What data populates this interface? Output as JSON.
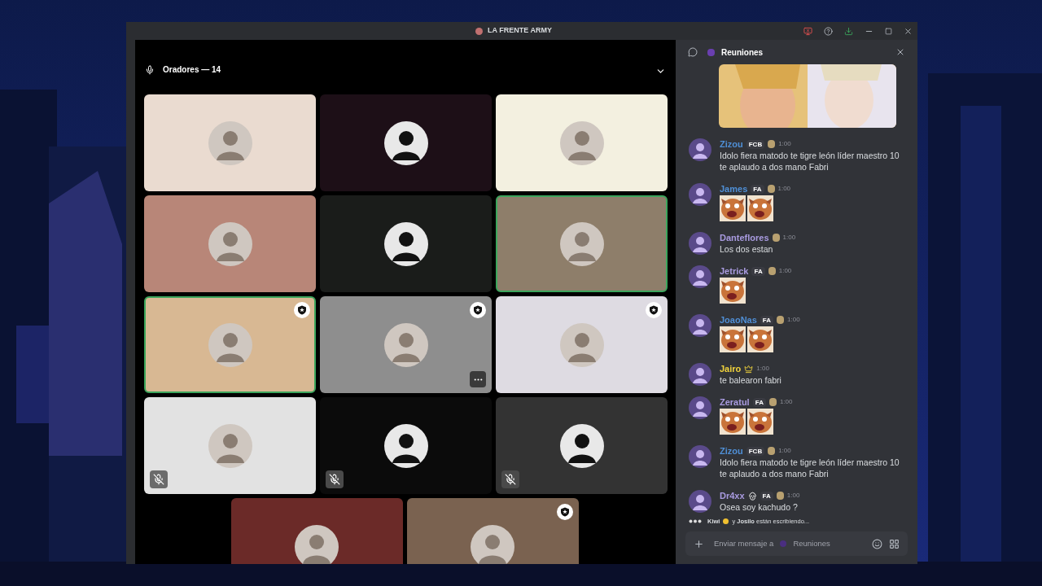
{
  "window": {
    "title": "LA FRENTE ARMY"
  },
  "stage": {
    "header": "Oradores — 14",
    "expanded": true,
    "tiles": [
      {
        "color": "#eadbd0",
        "speaking": false,
        "moderator": false,
        "muted": false,
        "menu": false
      },
      {
        "color": "#1d0f17",
        "speaking": false,
        "moderator": false,
        "muted": false,
        "menu": false
      },
      {
        "color": "#f3f0e0",
        "speaking": false,
        "moderator": false,
        "muted": false,
        "menu": false
      },
      {
        "color": "#b88678",
        "speaking": false,
        "moderator": false,
        "muted": false,
        "menu": false
      },
      {
        "color": "#1a1c1a",
        "speaking": false,
        "moderator": false,
        "muted": false,
        "menu": false
      },
      {
        "color": "#8e7e6a",
        "speaking": true,
        "moderator": false,
        "muted": false,
        "menu": false
      },
      {
        "color": "#d8b893",
        "speaking": true,
        "moderator": true,
        "muted": false,
        "menu": false
      },
      {
        "color": "#8e8e8e",
        "speaking": false,
        "moderator": true,
        "muted": false,
        "menu": true
      },
      {
        "color": "#dedbe2",
        "speaking": false,
        "moderator": true,
        "muted": false,
        "menu": false
      },
      {
        "color": "#e2e2e2",
        "speaking": false,
        "moderator": false,
        "muted": true,
        "menu": false
      },
      {
        "color": "#0b0b0b",
        "speaking": false,
        "moderator": false,
        "muted": true,
        "menu": false
      },
      {
        "color": "#333333",
        "speaking": false,
        "moderator": false,
        "muted": true,
        "menu": false
      },
      {
        "color": "#6b2a28",
        "speaking": false,
        "moderator": false
      },
      {
        "color": "#7a6250",
        "speaking": false,
        "moderator": true
      }
    ]
  },
  "chat": {
    "channel": "Reuniones",
    "messages": [
      {
        "author": "Zizou",
        "color": "#4f8fd6",
        "tag": "FCB",
        "time": "1:00",
        "kind": "text",
        "text": "Idolo fiera matodo te tigre león líder maestro 10 te aplaudo a dos mano Fabri"
      },
      {
        "author": "James",
        "color": "#4f8fd6",
        "tag": "FA",
        "time": "1:00",
        "kind": "stickers"
      },
      {
        "author": "Danteflores",
        "color": "#a99be0",
        "time": "1:00",
        "kind": "text",
        "text": "Los dos estan"
      },
      {
        "author": "Jetrick",
        "color": "#a99be0",
        "tag": "FA",
        "time": "1:00",
        "kind": "stickers"
      },
      {
        "author": "JoaoNas",
        "color": "#4f8fd6",
        "tag": "FA",
        "time": "1:00",
        "kind": "stickers"
      },
      {
        "author": "Jairo",
        "color": "#f0d23c",
        "time": "1:00",
        "kind": "text",
        "text": "te balearon fabri"
      },
      {
        "author": "Zeratul",
        "color": "#a99be0",
        "tag": "FA",
        "time": "1:00",
        "kind": "stickers"
      },
      {
        "author": "Zizou",
        "color": "#4f8fd6",
        "tag": "FCB",
        "time": "1:00",
        "kind": "text",
        "text": "Idolo fiera matodo te tigre león líder maestro 10 te aplaudo a dos mano Fabri"
      },
      {
        "author": "Dr4xx",
        "color": "#a99be0",
        "tag": "FA",
        "time": "1:00",
        "kind": "text",
        "text": "Osea soy kachudo ?"
      }
    ],
    "typing": {
      "first": "Kiwi",
      "rest": "y **Josilo** están escribiendo..."
    },
    "composer": {
      "prompt": "Enviar mensaje a",
      "channel": "Reuniones"
    }
  }
}
